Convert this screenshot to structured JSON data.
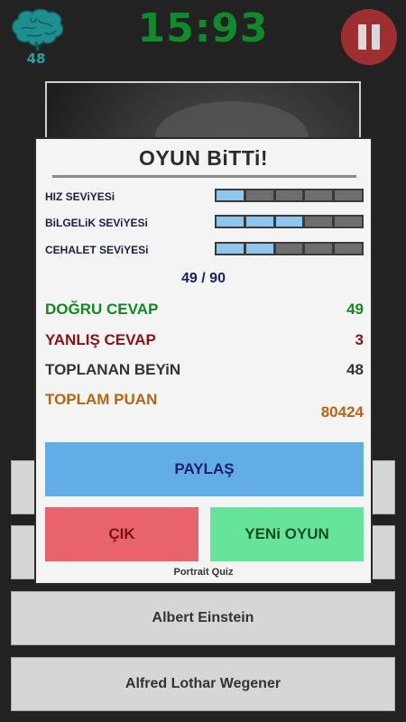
{
  "header": {
    "brain_count": "48",
    "timer": "15:93"
  },
  "answers": [
    {
      "label": ""
    },
    {
      "label": ""
    },
    {
      "label": "Albert Einstein"
    },
    {
      "label": "Alfred Lothar Wegener"
    }
  ],
  "dialog": {
    "title": "OYUN BiTTi!",
    "levels": [
      {
        "label": "HIZ SEViYESi",
        "filled": 1,
        "total": 5
      },
      {
        "label": "BiLGELiK SEViYESi",
        "filled": 3,
        "total": 5
      },
      {
        "label": "CEHALET SEViYESi",
        "filled": 2,
        "total": 5
      }
    ],
    "progress": "49 / 90",
    "stats": {
      "correct": {
        "label": "DOĞRU CEVAP",
        "value": "49",
        "color": "#0e8a1e"
      },
      "wrong": {
        "label": "YANLIŞ CEVAP",
        "value": "3",
        "color": "#8c1212"
      },
      "brains": {
        "label": "TOPLANAN BEYiN",
        "value": "48",
        "color": "#333333"
      },
      "points": {
        "label": "TOPLAM PUAN",
        "value": "80424",
        "color": "#b5650f"
      }
    },
    "share_label": "PAYLAŞ",
    "quit_label": "ÇIK",
    "new_game_label": "YENi OYUN",
    "app_name": "Portrait Quiz"
  },
  "icons": {
    "brain": "brain-icon",
    "pause": "pause-icon"
  },
  "colors": {
    "timer": "#0e8b2a",
    "brain": "#1fa3a3",
    "pause_bg": "#9e2f30",
    "share_bg": "#62ade6",
    "quit_bg": "#e8636b",
    "new_bg": "#66e59a",
    "level_on": "#8ec7ee"
  }
}
